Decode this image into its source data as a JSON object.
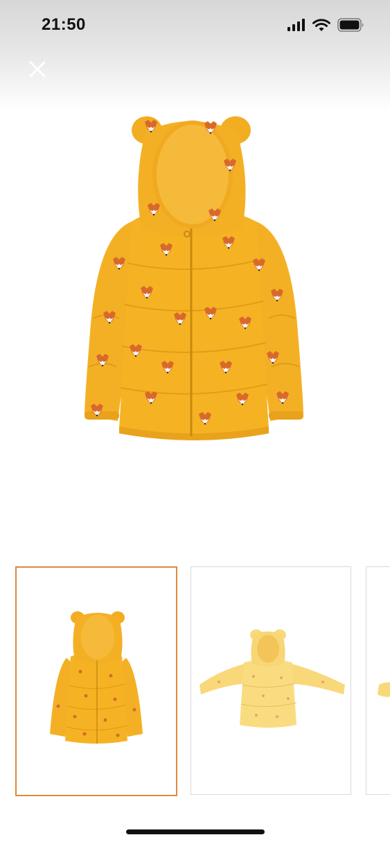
{
  "status_bar": {
    "time": "21:50",
    "icons": [
      "signal-icon",
      "wifi-icon",
      "battery-icon"
    ]
  },
  "header": {
    "close_icon": "close-icon"
  },
  "gallery": {
    "main_image_alt": "",
    "jacket_color": "#F5B324",
    "selected_index": 0,
    "thumbnails": [
      {
        "name": "thumbnail-front-view"
      },
      {
        "name": "thumbnail-back-view"
      },
      {
        "name": "thumbnail-side-view"
      }
    ],
    "accent_color": "#E0893A"
  }
}
